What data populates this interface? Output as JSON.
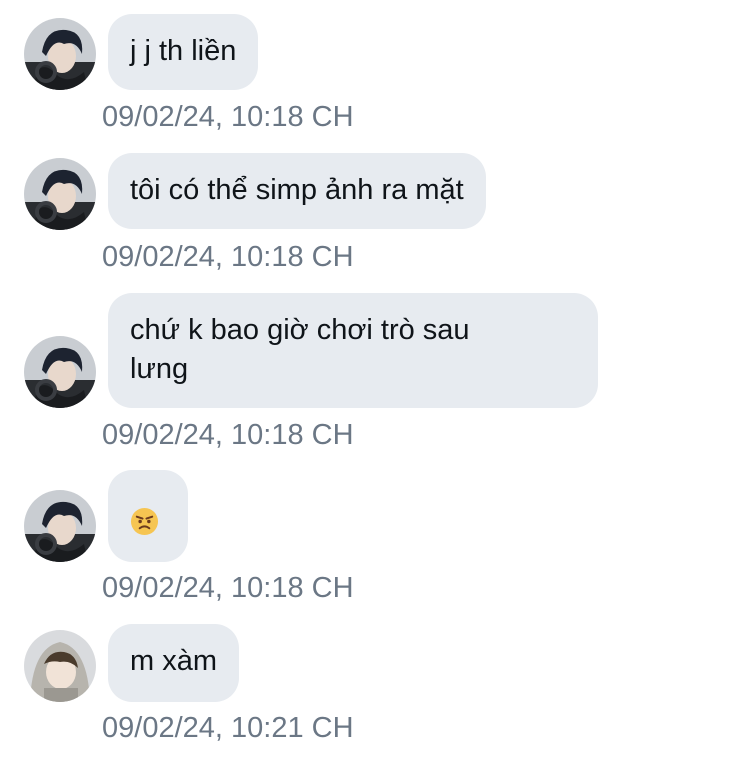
{
  "conversation": {
    "messages": [
      {
        "sender": "other",
        "text": "j j th liền",
        "timestamp": "09/02/24, 10:18 CH"
      },
      {
        "sender": "other",
        "text": "tôi có thể simp ảnh ra mặt",
        "timestamp": "09/02/24, 10:18 CH"
      },
      {
        "sender": "other",
        "text": "chứ k bao giờ chơi trò sau\nlưng",
        "timestamp": "09/02/24, 10:18 CH"
      },
      {
        "sender": "other",
        "emoji": "angry-face-emoji",
        "timestamp": "09/02/24, 10:18 CH"
      },
      {
        "sender": "other2",
        "text": "m xàm",
        "timestamp": "09/02/24, 10:21 CH"
      }
    ]
  },
  "colors": {
    "bubble_bg": "#e7ebf0",
    "timestamp_text": "#6b7785",
    "message_text": "#0f1419"
  }
}
